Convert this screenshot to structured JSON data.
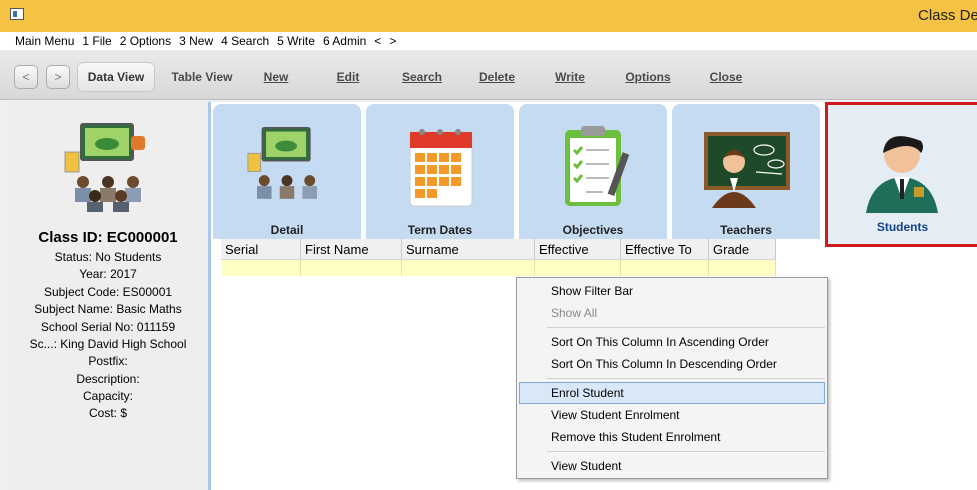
{
  "window": {
    "title": "Class Det"
  },
  "menu": [
    "Main Menu",
    "1 File",
    "2 Options",
    "3 New",
    "4 Search",
    "5 Write",
    "6 Admin",
    "<",
    ">"
  ],
  "toolbar": {
    "back": "<",
    "forward": ">",
    "data_view": "Data View",
    "table_view": "Table View",
    "new": "New",
    "edit": "Edit",
    "search": "Search",
    "delete": "Delete",
    "write": "Write",
    "options": "Options",
    "close": "Close"
  },
  "class_info": {
    "title": "Class ID: EC000001",
    "status": "Status: No Students",
    "year": "Year: 2017",
    "subject_code": "Subject Code: ES00001",
    "subject_name": "Subject Name: Basic Maths",
    "school_serial": "School Serial No: 011159",
    "school": "Sc...: King David High School",
    "postfix": "Postfix:",
    "description": "Description:",
    "capacity": "Capacity:",
    "cost": "Cost: $"
  },
  "tabs": [
    "Detail",
    "Term Dates",
    "Objectives",
    "Teachers",
    "Students"
  ],
  "selected_tab": "Students",
  "grid": {
    "columns": [
      "Serial",
      "First Name",
      "Surname",
      "Effective",
      "Effective To",
      "Grade"
    ]
  },
  "context_menu": {
    "show_filter_bar": "Show Filter Bar",
    "show_all": "Show All",
    "sort_asc": "Sort On This Column In Ascending Order",
    "sort_desc": "Sort On This Column In Descending Order",
    "enrol_student": "Enrol Student",
    "view_enrolment": "View Student Enrolment",
    "remove_enrolment": "Remove this Student Enrolment",
    "view_student": "View Student"
  },
  "colors": {
    "titlebar": "#f6c243",
    "tab_bg": "#c5dbf1",
    "selected_outline": "#d0191c",
    "grid_row": "#fdfdc4"
  }
}
